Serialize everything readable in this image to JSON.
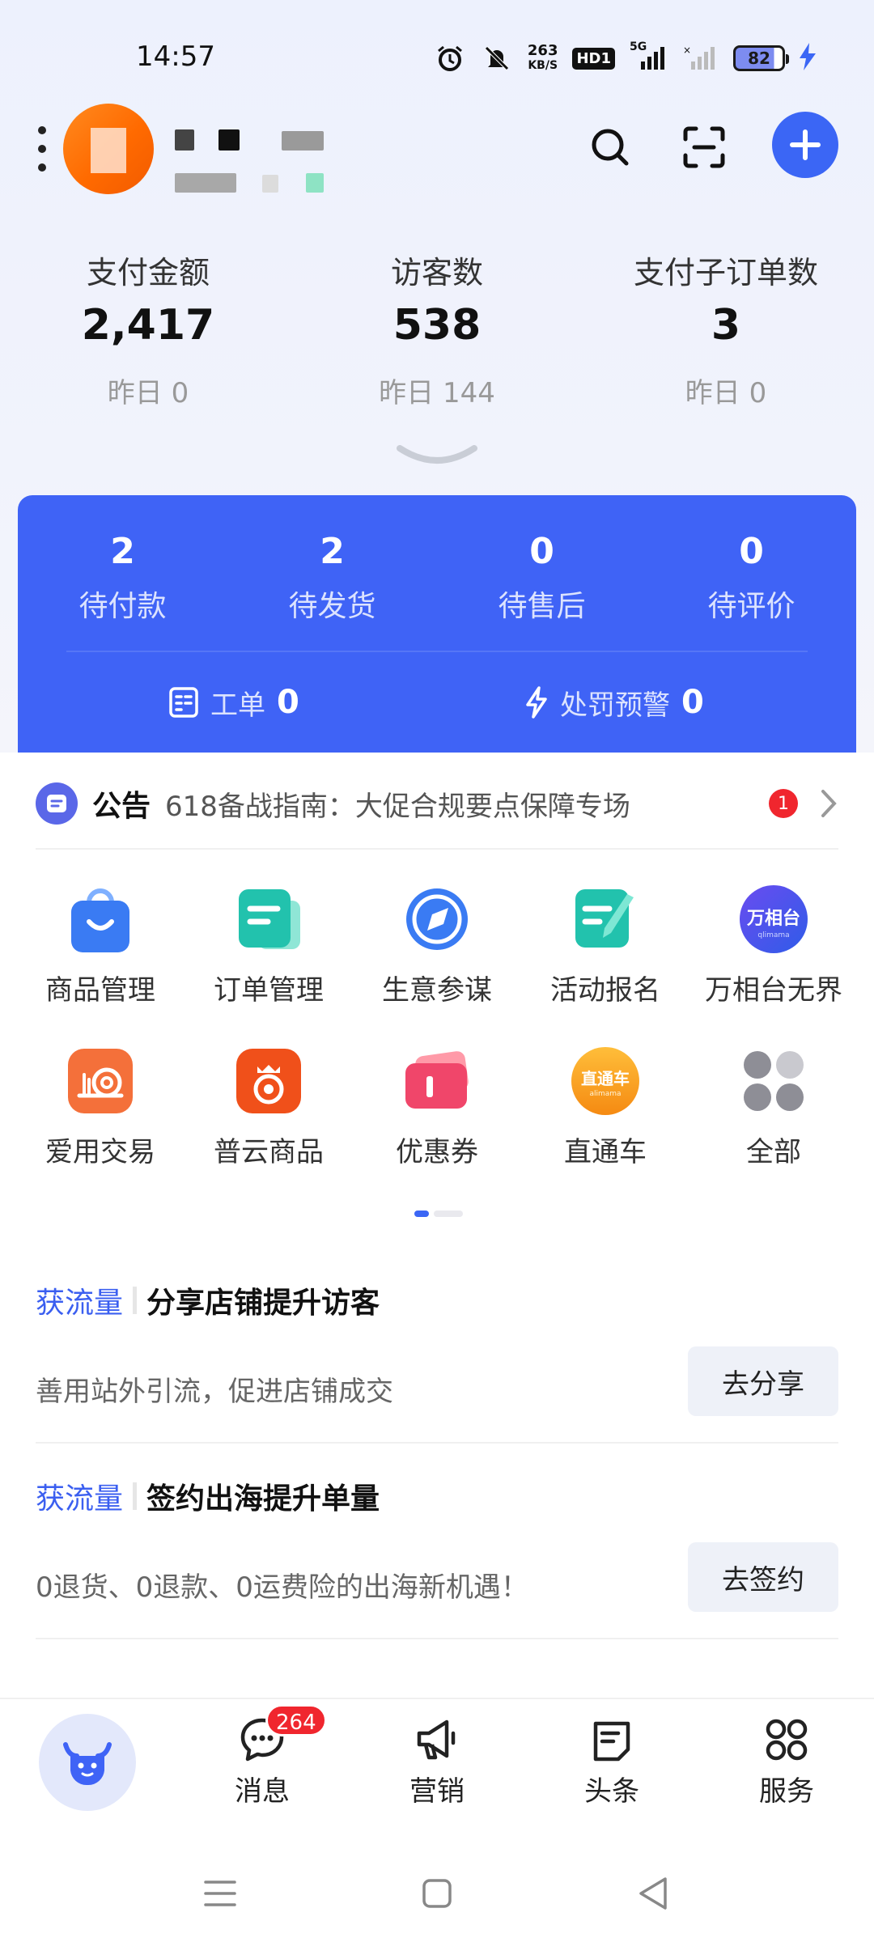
{
  "status_bar": {
    "time": "14:57",
    "net_speed_value": "263",
    "net_speed_unit": "KB/S",
    "hd_label": "HD1",
    "signal_label": "5G",
    "battery_level": "82"
  },
  "header": {
    "icons": [
      "menu-icon",
      "search-icon",
      "scan-icon",
      "plus-icon"
    ]
  },
  "stats": [
    {
      "label": "支付金额",
      "value": "2,417",
      "prev": "昨日 0"
    },
    {
      "label": "访客数",
      "value": "538",
      "prev": "昨日 144"
    },
    {
      "label": "支付子订单数",
      "value": "3",
      "prev": "昨日 0"
    }
  ],
  "orders": {
    "items": [
      {
        "count": "2",
        "label": "待付款"
      },
      {
        "count": "2",
        "label": "待发货"
      },
      {
        "count": "0",
        "label": "待售后"
      },
      {
        "count": "0",
        "label": "待评价"
      }
    ],
    "work_order": {
      "label": "工单",
      "count": "0"
    },
    "penalty": {
      "label": "处罚预警",
      "count": "0"
    }
  },
  "notice": {
    "title": "公告",
    "text": "618备战指南：大促合规要点保障专场",
    "badge": "1"
  },
  "grid": [
    {
      "label": "商品管理",
      "icon": "bag-icon",
      "color": "#3a7bf3"
    },
    {
      "label": "订单管理",
      "icon": "order-doc-icon",
      "color": "#22c2ad"
    },
    {
      "label": "生意参谋",
      "icon": "compass-icon",
      "color": "#3a7bf3"
    },
    {
      "label": "活动报名",
      "icon": "signup-pen-icon",
      "color": "#22c2ad"
    },
    {
      "label": "万相台无界",
      "icon": "wanxiangtai-logo-icon",
      "color": "#4c4fe0",
      "logo_text": "万相台",
      "logo_sub": "qlimama"
    },
    {
      "label": "爱用交易",
      "icon": "snail-icon",
      "color": "#f4703a"
    },
    {
      "label": "普云商品",
      "icon": "crown-swirl-icon",
      "color": "#f0501a"
    },
    {
      "label": "优惠券",
      "icon": "coupon-icon",
      "color": "#f0466a"
    },
    {
      "label": "直通车",
      "icon": "ztc-logo-icon",
      "color": "#f7a224",
      "logo_text": "直通车",
      "logo_sub": "alimama"
    },
    {
      "label": "全部",
      "icon": "all-dots-icon",
      "color": "#8e8e96"
    }
  ],
  "promos": [
    {
      "tag": "获流量",
      "title": "分享店铺提升访客",
      "desc": "善用站外引流，促进店铺成交",
      "button": "去分享"
    },
    {
      "tag": "获流量",
      "title": "签约出海提升单量",
      "desc": "0退货、0退款、0运费险的出海新机遇！",
      "button": "去签约"
    }
  ],
  "tabbar": {
    "home_icon": "bull-mascot-icon",
    "tabs": [
      {
        "label": "消息",
        "icon": "chat-bubble-icon",
        "badge": "264"
      },
      {
        "label": "营销",
        "icon": "megaphone-icon"
      },
      {
        "label": "头条",
        "icon": "article-icon"
      },
      {
        "label": "服务",
        "icon": "grid-circles-icon"
      }
    ]
  },
  "colors": {
    "accent": "#3b66f5",
    "order_card": "#3f63f6",
    "badge_red": "#f0262e",
    "promo_tag": "#3b5ff0"
  }
}
